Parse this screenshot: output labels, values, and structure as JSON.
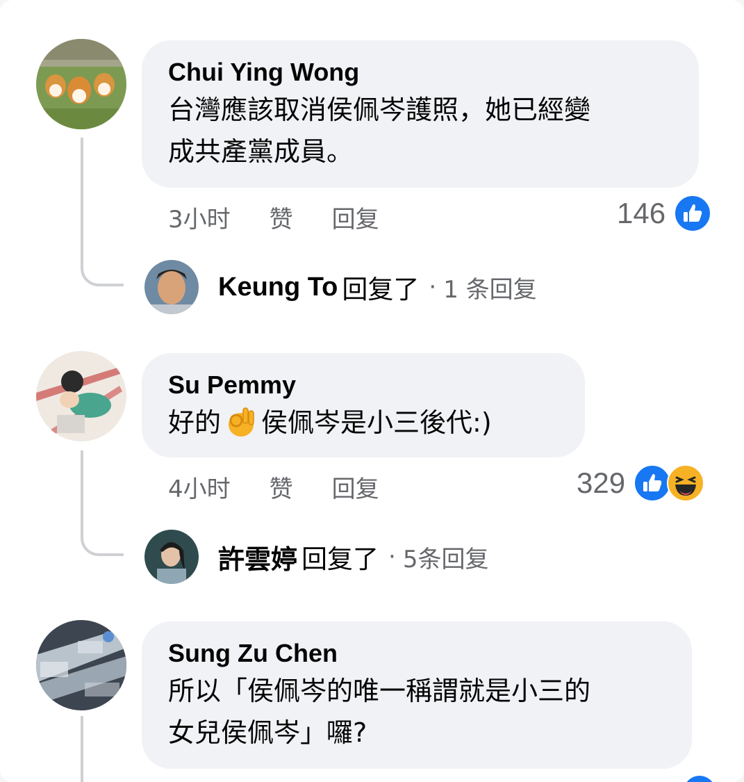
{
  "colors": {
    "bubble_bg": "#f0f2f5",
    "meta_text": "#65676b",
    "like_blue": "#1877f2",
    "haha_yellow": "#f7b125"
  },
  "comments": [
    {
      "author": "Chui Ying Wong",
      "text_line1": "台灣應該取消侯佩岑護照，她已經變",
      "text_line2": "成共產黨成員。",
      "time": "3小时",
      "like_label": "赞",
      "reply_label": "回复",
      "reaction_count": "146",
      "reaction_icons": [
        "like-icon"
      ],
      "replies": {
        "replier": "Keung To",
        "verb": "回复了",
        "separator": "·",
        "count_text": "1 条回复"
      }
    },
    {
      "author": "Su Pemmy",
      "text_before_emoji": "好的",
      "emoji": "ok-hand-emoji",
      "text_after_emoji": "侯佩岑是小三後代:)",
      "time": "4小时",
      "like_label": "赞",
      "reply_label": "回复",
      "reaction_count": "329",
      "reaction_icons": [
        "like-icon",
        "haha-icon"
      ],
      "replies": {
        "replier": "許雲婷",
        "verb": "回复了",
        "separator": "·",
        "count_text": "5条回复"
      }
    },
    {
      "author": "Sung Zu Chen",
      "text_line1": "所以「侯佩岑的唯一稱謂就是小三的",
      "text_line2": "女兒侯佩岑」囉?"
    }
  ]
}
